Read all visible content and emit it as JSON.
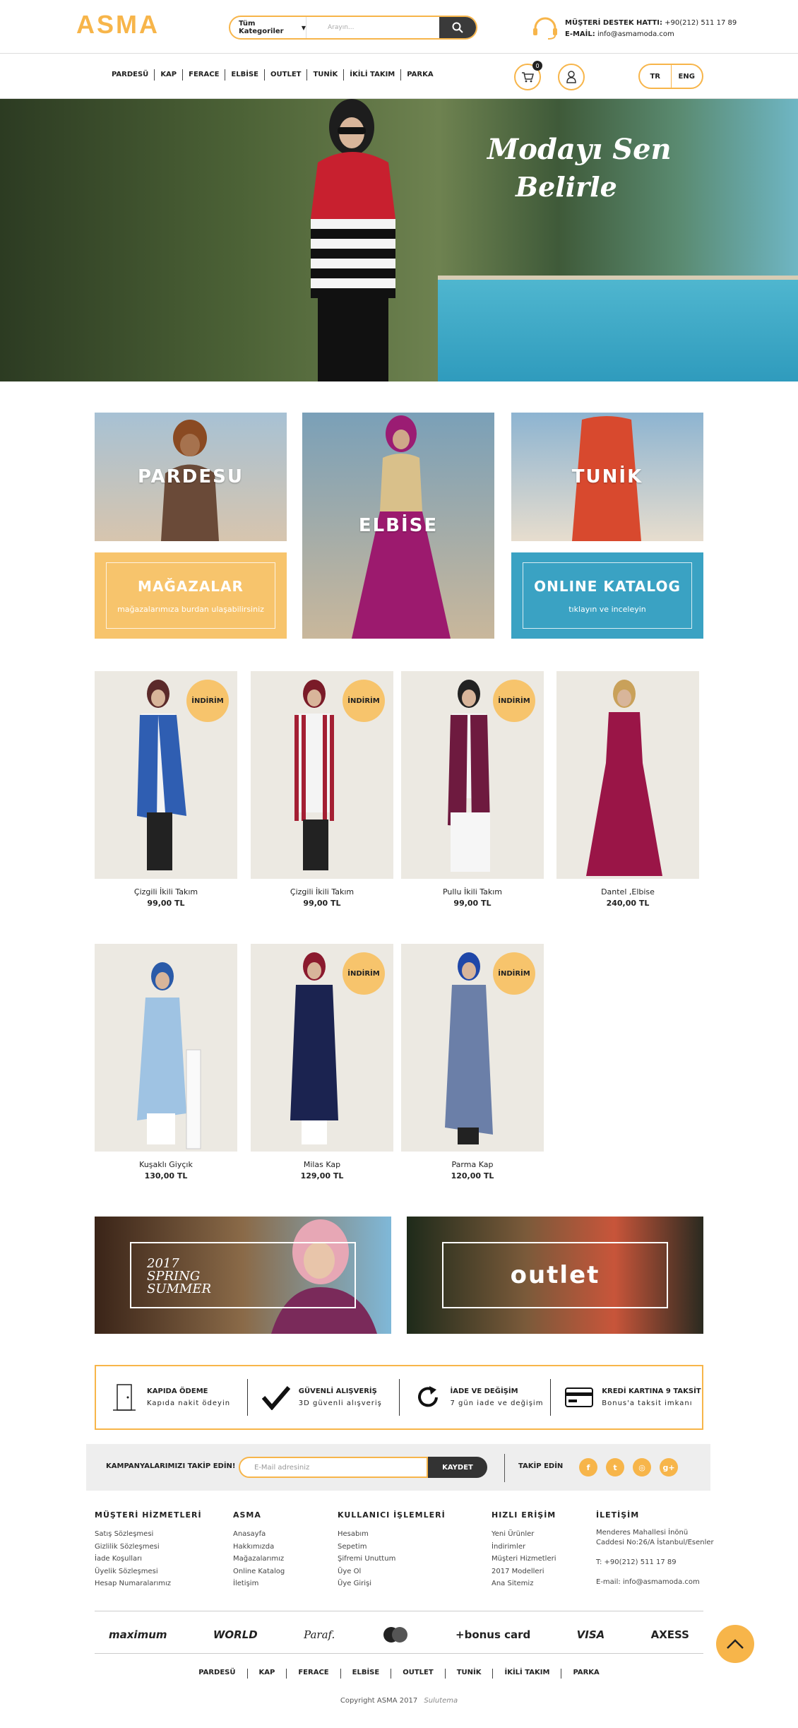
{
  "header": {
    "logo": "ASMA",
    "search": {
      "category": "Tüm Kategoriler",
      "placeholder": "Arayın..."
    },
    "support_label": "MÜŞTERİ DESTEK HATTI:",
    "support_phone": "+90(212) 511 17 89",
    "email_label": "E-MAİL:",
    "email": "info@asmamoda.com"
  },
  "nav": {
    "items": [
      "PARDESÜ",
      "KAP",
      "FERACE",
      "ELBİSE",
      "OUTLET",
      "TUNİK",
      "İKİLİ TAKIM",
      "PARKA"
    ],
    "cart_count": "0",
    "lang": [
      "TR",
      "ENG"
    ]
  },
  "hero": {
    "line1": "Modayı Sen",
    "line2": "Belirle"
  },
  "categories": {
    "pardesu": "PARDESU",
    "elbise": "ELBİSE",
    "tunik": "TUNİK",
    "stores": {
      "title": "MAĞAZALAR",
      "subtitle": "mağazalarımıza burdan ulaşabilirsiniz"
    },
    "catalog": {
      "title": "ONLINE KATALOG",
      "subtitle": "tıklayın ve inceleyin"
    }
  },
  "badge": "İNDİRİM",
  "products": [
    {
      "name": "Çizgili İkili Takım",
      "price": "99,00 TL",
      "sale": true
    },
    {
      "name": "Çizgili İkili Takım",
      "price": "99,00 TL",
      "sale": true
    },
    {
      "name": "Pullu İkili Takım",
      "price": "99,00 TL",
      "sale": true
    },
    {
      "name": "Dantel ,Elbise",
      "price": "240,00 TL",
      "sale": false
    },
    {
      "name": "Kuşaklı Giyçık",
      "price": "130,00 TL",
      "sale": false
    },
    {
      "name": "Milas Kap",
      "price": "129,00 TL",
      "sale": true
    },
    {
      "name": "Parma Kap",
      "price": "120,00 TL",
      "sale": true
    }
  ],
  "promos": {
    "spring": [
      "2017",
      "SPRING",
      "SUMMER"
    ],
    "outlet": "outlet"
  },
  "features": [
    {
      "title": "KAPIDA ÖDEME",
      "subtitle": "Kapıda nakit ödeyin"
    },
    {
      "title": "GÜVENLİ ALIŞVERİŞ",
      "subtitle": "3D güvenli alışveriş"
    },
    {
      "title": "İADE VE DEĞİŞİM",
      "subtitle": "7 gün iade ve değişim"
    },
    {
      "title": "KREDİ KARTINA 9 TAKSİT",
      "subtitle": "Bonus'a taksit imkanı"
    }
  ],
  "newsletter": {
    "label": "KAMPANYALARIMIZI TAKİP EDİN!",
    "placeholder": "E-Mail adresiniz",
    "button": "KAYDET",
    "follow": "TAKİP EDİN"
  },
  "footer": {
    "columns": [
      {
        "title": "MÜŞTERİ HİZMETLERİ",
        "items": [
          "Satış Sözleşmesi",
          "Gizlilik Sözleşmesi",
          "İade Koşulları",
          "Üyelik Sözleşmesi",
          "Hesap Numaralarımız"
        ]
      },
      {
        "title": "ASMA",
        "items": [
          "Anasayfa",
          "Hakkımızda",
          "Mağazalarımız",
          "Online Katalog",
          "İletişim"
        ]
      },
      {
        "title": "KULLANICI İŞLEMLERİ",
        "items": [
          "Hesabım",
          "Sepetim",
          "Şifremi Unuttum",
          "Üye Ol",
          "Üye Girişi"
        ]
      },
      {
        "title": "HIZLI ERİŞİM",
        "items": [
          "Yeni Ürünler",
          "İndirimler",
          "Müşteri Hizmetleri",
          "2017 Modelleri",
          "Ana Sitemiz"
        ]
      },
      {
        "title": "İLETİŞİM",
        "items": [
          "Menderes Mahallesi İnönü",
          "Caddesi No:26/A İstanbul/Esenler",
          "",
          "T: +90(212) 511 17 89",
          "",
          "E-mail: info@asmamoda.com"
        ]
      }
    ],
    "cards": [
      "maximum",
      "WORLD",
      "Paraf.",
      "MasterCard",
      "+bonus card",
      "VISA",
      "AXESS"
    ],
    "copyright": "Copyright ASMA 2017",
    "credit": "Sulutema"
  },
  "colors": {
    "accent": "#f7b54a",
    "catalog_blue": "#3aa2c3",
    "dark": "#333333"
  }
}
